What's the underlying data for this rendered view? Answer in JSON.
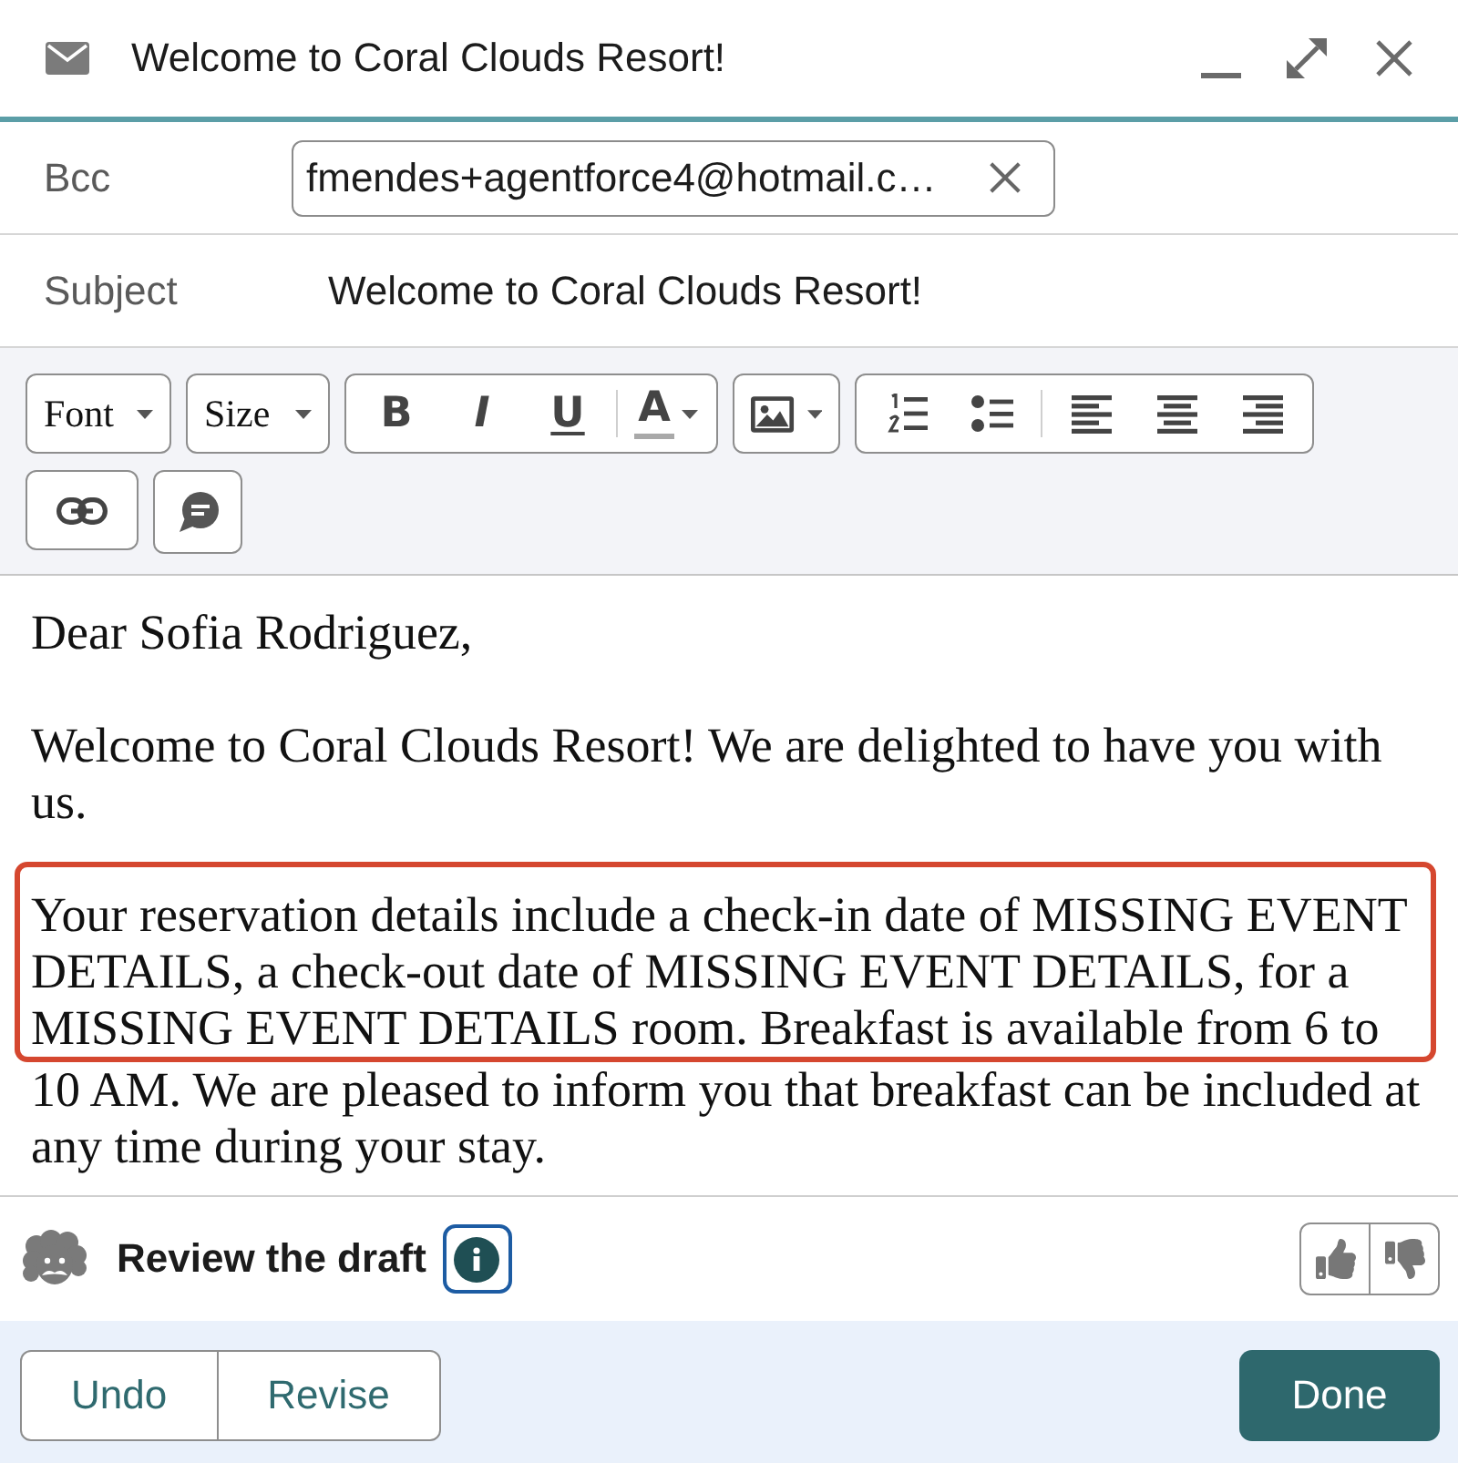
{
  "window": {
    "title": "Welcome to Coral Clouds Resort!"
  },
  "recipients": {
    "label": "Bcc",
    "chips": [
      {
        "text": "fmendes+agentforce4@hotmail.c…"
      }
    ]
  },
  "subject": {
    "label": "Subject",
    "value": "Welcome to Coral Clouds Resort!"
  },
  "toolbar": {
    "groups": [
      {
        "sections": [
          [
            {
              "kind": "font",
              "label": "Font",
              "menu": true
            }
          ]
        ]
      },
      {
        "sections": [
          [
            {
              "kind": "size",
              "label": "Size",
              "menu": true
            }
          ]
        ]
      },
      {
        "sections": [
          [
            {
              "kind": "bold",
              "label": "B",
              "menu": false
            },
            {
              "kind": "italic",
              "label": "I",
              "menu": false
            },
            {
              "kind": "underline",
              "label": "U",
              "menu": false
            }
          ],
          [
            {
              "kind": "text-color",
              "label": "A",
              "menu": true
            }
          ]
        ]
      },
      {
        "sections": [
          [
            {
              "kind": "image",
              "menu": true
            }
          ]
        ]
      },
      {
        "sections": [
          [
            {
              "kind": "numbered-list",
              "menu": false
            },
            {
              "kind": "bulleted-list",
              "menu": false
            }
          ],
          [
            {
              "kind": "align-left",
              "menu": false
            },
            {
              "kind": "align-center",
              "menu": false
            },
            {
              "kind": "align-right",
              "menu": false
            }
          ]
        ]
      },
      {
        "sections": [
          [
            {
              "kind": "link",
              "menu": false
            }
          ]
        ]
      },
      {
        "sections": [
          [
            {
              "kind": "comment",
              "menu": false
            }
          ]
        ]
      }
    ]
  },
  "body": {
    "paragraphs": [
      {
        "segments": [
          {
            "text": "Dear Sofia Rodriguez,",
            "highlighted": false
          }
        ]
      },
      {
        "segments": [
          {
            "text": "Welcome to Coral Clouds Resort! We are delighted to have you with us.",
            "highlighted": false
          }
        ]
      },
      {
        "segments": [
          {
            "text": "Your reservation details include a check-in date of MISSING EVENT DETAILS, a check-out date of MISSING EVENT DETAILS, for a MISSING EVENT DETAILS room. Breakfast is available from 6 to",
            "highlighted": true
          },
          {
            "text": "10 AM. We are pleased to inform you that breakfast can be included at any time during your stay.",
            "highlighted": false
          }
        ]
      }
    ]
  },
  "review": {
    "title": "Review the draft"
  },
  "footer": {
    "draft_actions": [
      {
        "label": "Undo"
      },
      {
        "label": "Revise"
      }
    ],
    "primary_action": {
      "label": "Done"
    }
  }
}
